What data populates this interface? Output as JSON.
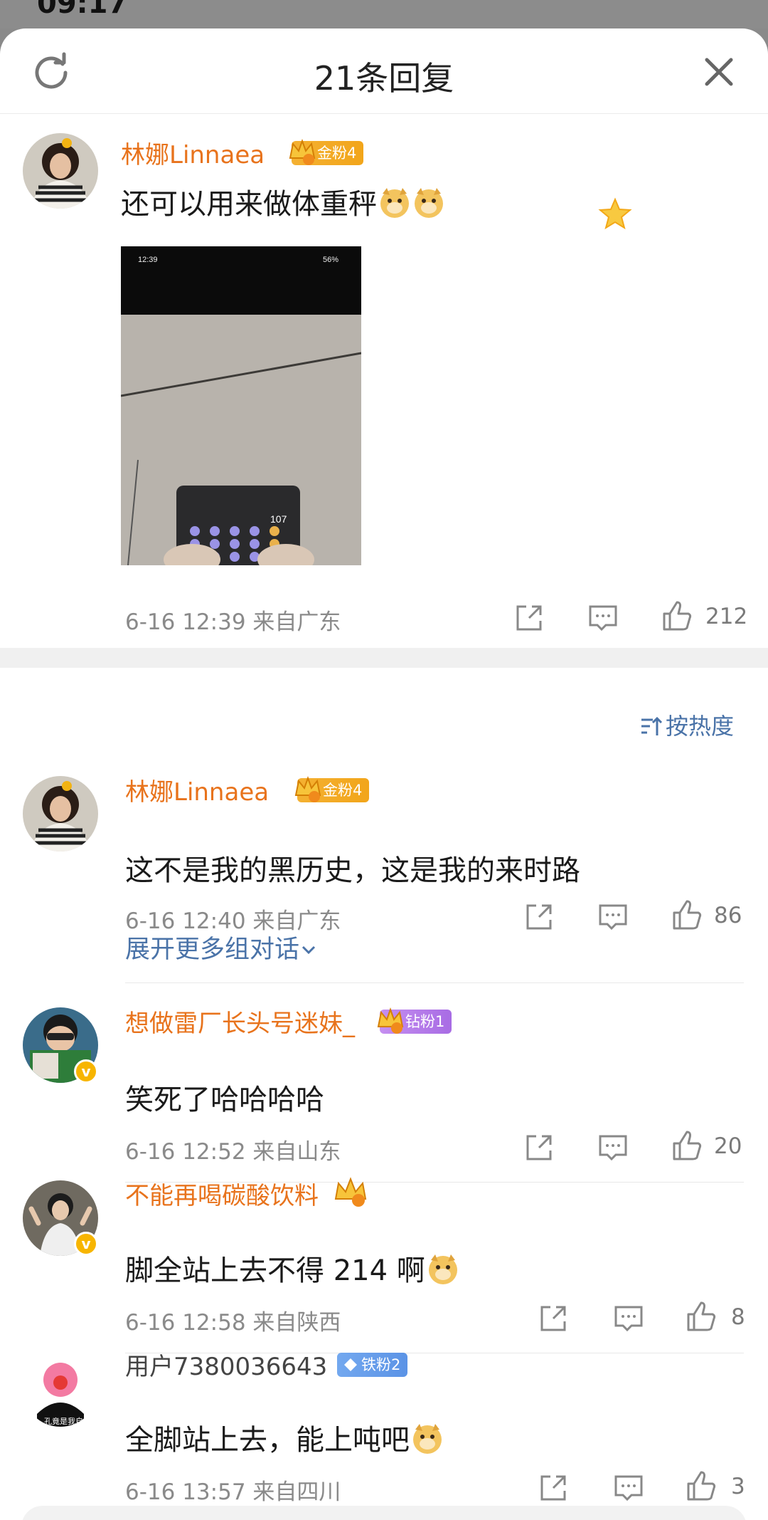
{
  "header": {
    "title": "21条回复"
  },
  "main_comment": {
    "username": "林娜Linnaea",
    "fan_badge": "金粉4",
    "text": "还可以用来做体重秤",
    "photo": {
      "time": "12:39",
      "battery": "56%",
      "display_value": "107"
    },
    "meta": "6-16 12:39  来自广东",
    "likes": "212"
  },
  "sort": {
    "label": "按热度"
  },
  "replies": [
    {
      "username": "林娜Linnaea",
      "fan_badge": "金粉4",
      "text": "这不是我的黑历史，这是我的来时路",
      "meta": "6-16 12:40  来自广东",
      "likes": "86"
    },
    {
      "username": "想做雷厂长头号迷妹_",
      "fan_badge": "钻粉1",
      "text": "笑死了哈哈哈哈",
      "meta": "6-16 12:52  来自山东",
      "likes": "20"
    },
    {
      "username": "不能再喝碳酸饮料",
      "fan_badge": "",
      "text": "脚全站上去不得 214 啊",
      "meta": "6-16 12:58  来自陕西",
      "likes": "8"
    },
    {
      "username": "用户7380036643",
      "fan_badge": "铁粉2",
      "text": "全脚站上去，能上吨吧",
      "meta": "6-16 13:57  来自四川",
      "likes": "3"
    }
  ],
  "expand_label": "展开更多组对话",
  "icons": [
    "refresh-icon",
    "close-icon",
    "share-icon",
    "comment-icon",
    "like-icon",
    "sort-icon",
    "doge-emoji-icon",
    "crown-icon"
  ],
  "colors": {
    "username_orange": "#e8731c",
    "link_blue": "#4a73a8",
    "meta_gray": "#8a8a8a"
  }
}
